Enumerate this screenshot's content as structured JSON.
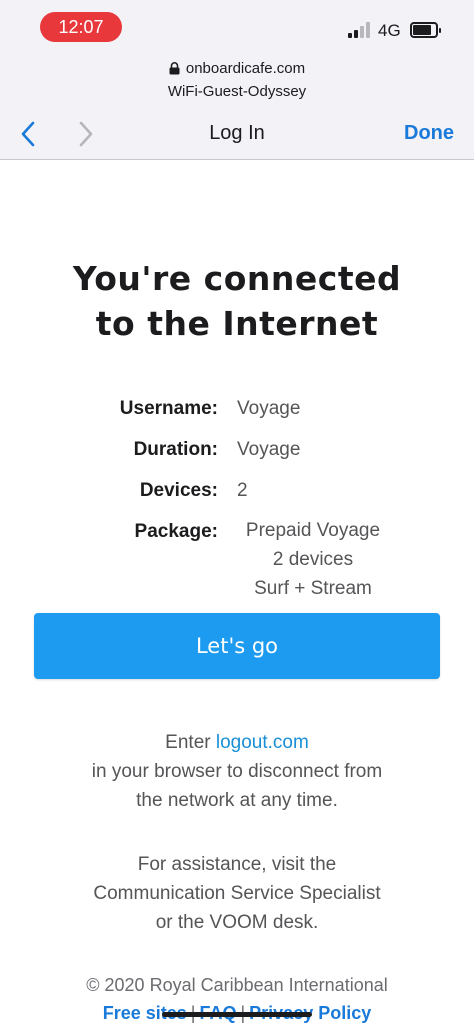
{
  "status_bar": {
    "time": "12:07",
    "network": "4G",
    "colors": {
      "time_pill": "#e8383b"
    }
  },
  "browser": {
    "domain": "onboardicafe.com",
    "network_name": "WiFi-Guest-Odyssey",
    "title": "Log In",
    "done_label": "Done",
    "icons": {
      "back": "chevron-left-icon",
      "forward": "chevron-right-icon",
      "lock": "lock-icon"
    }
  },
  "main": {
    "heading_line1": "You're connected",
    "heading_line2": "to the Internet",
    "info": {
      "username_label": "Username:",
      "username_value": "Voyage",
      "duration_label": "Duration:",
      "duration_value": "Voyage",
      "devices_label": "Devices:",
      "devices_value": "2",
      "package_label": "Package:",
      "package_lines": [
        "Prepaid Voyage",
        "2 devices",
        "Surf + Stream"
      ]
    },
    "button_label": "Let's go",
    "logout": {
      "prefix": "Enter",
      "link": "logout.com",
      "line2": "in your browser to disconnect from",
      "line3": "the network at any time."
    },
    "assistance": {
      "line1": "For assistance, visit the",
      "line2": "Communication Service Specialist",
      "line3": "or the VOOM desk."
    }
  },
  "footer": {
    "copyright": "© 2020 Royal Caribbean International",
    "links": [
      "Free sites",
      "FAQ",
      "Privacy Policy"
    ],
    "separator": "|"
  },
  "colors": {
    "accent": "#1d9bf0",
    "link": "#1a7ad9"
  }
}
